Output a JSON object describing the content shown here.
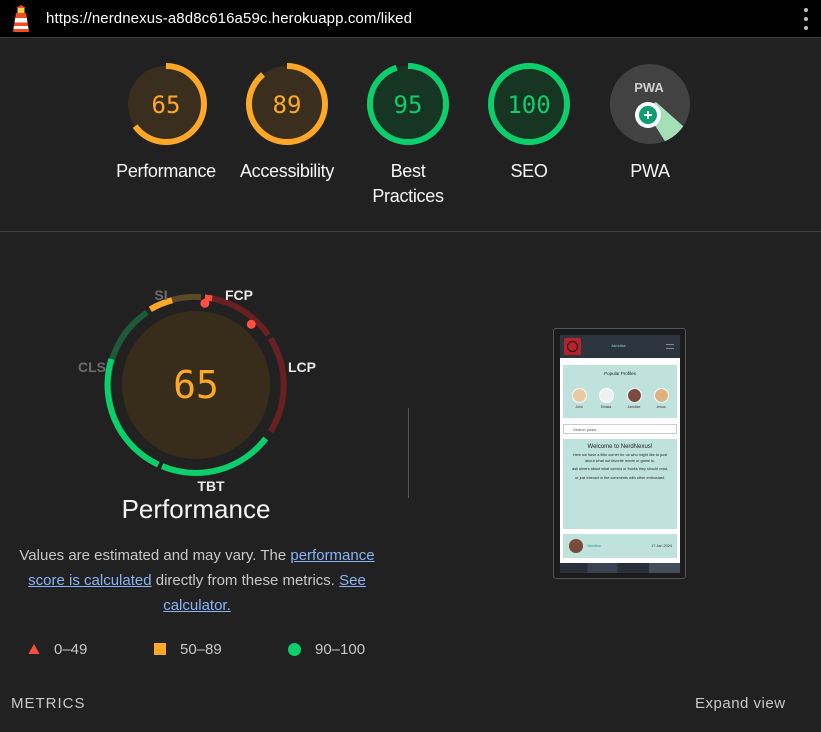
{
  "header": {
    "url": "https://nerdnexus-a8d8c616a59c.herokuapp.com/liked"
  },
  "scores": [
    {
      "label": "Performance",
      "score": "65",
      "value": 65,
      "status": "average"
    },
    {
      "label": "Accessibility",
      "score": "89",
      "value": 89,
      "status": "average"
    },
    {
      "label": "Best Practices",
      "score": "95",
      "value": 95,
      "status": "pass"
    },
    {
      "label": "SEO",
      "score": "100",
      "value": 100,
      "status": "pass"
    },
    {
      "label": "PWA",
      "score": "PWA",
      "status": "pwa"
    }
  ],
  "colors": {
    "average": "#ffa726",
    "average_bg": "#3a2f1f",
    "pass": "#0cce6b",
    "pass_bg": "#173523",
    "fail": "#ff4e42",
    "pwa_bg": "#424242"
  },
  "performance": {
    "score": "65",
    "title": "Performance",
    "metric_labels": {
      "fcp": "FCP",
      "lcp": "LCP",
      "tbt": "TBT",
      "cls": "CLS",
      "si": "SI"
    }
  },
  "description": {
    "text1": "Values are estimated and may vary. The ",
    "link1": "performance score is calculated",
    "text2": " directly from these metrics. ",
    "link2": "See calculator."
  },
  "legend": [
    {
      "range": "0–49",
      "icon": "triangle-icon",
      "color": "#ff4e42"
    },
    {
      "range": "50–89",
      "icon": "square-icon",
      "color": "#ffa726"
    },
    {
      "range": "90–100",
      "icon": "circle-icon",
      "color": "#0cce6b"
    }
  ],
  "screenshot": {
    "username": "Jamdise",
    "popular_title": "Popular Profiles",
    "profiles": [
      "John",
      "Shiaka",
      "Jamdise",
      "Jesus"
    ],
    "search_placeholder": "Search posts",
    "welcome_title": "Welcome to NerdNexus!",
    "welcome_p1": "Here we have a little corner for us who might like to post about what our favorite movie or game is,",
    "welcome_p2": "ask others about what comics or books they should read,",
    "welcome_p3": "or just interact in the comments with other enthusiast.",
    "post_author": "Jamdise",
    "post_date": "17 Jan 2024"
  },
  "metrics": {
    "label": "METRICS",
    "expand_label": "Expand view"
  }
}
